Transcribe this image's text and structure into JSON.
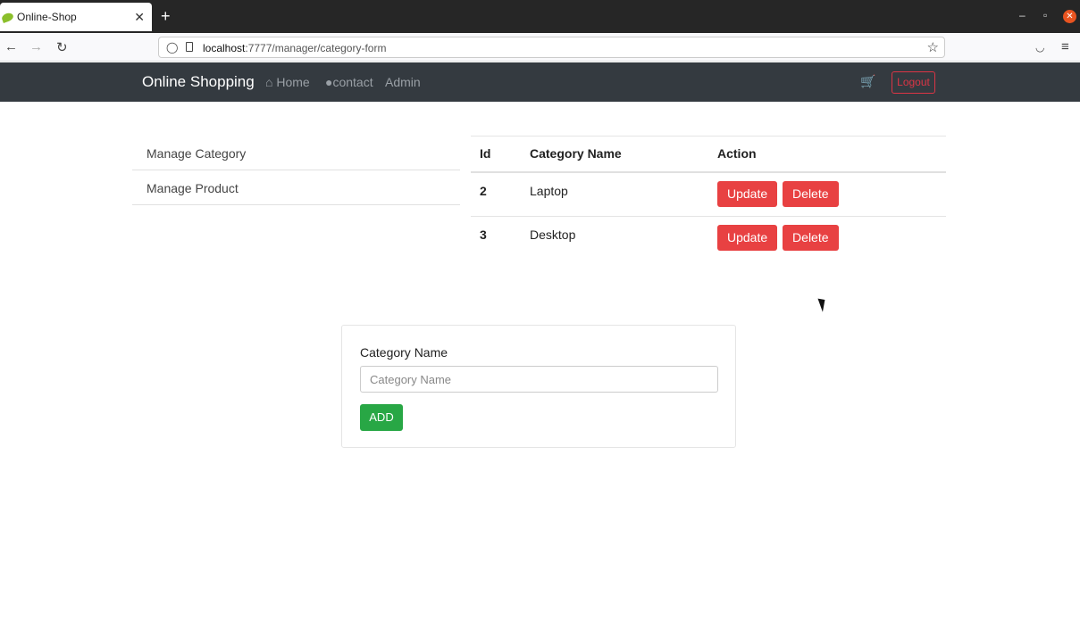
{
  "browser": {
    "tab_title": "Online-Shop",
    "tab_close": "✕",
    "new_tab": "+",
    "url_host": "localhost",
    "url_rest": ":7777/manager/category-form"
  },
  "site": {
    "brand": "Online Shopping",
    "nav": [
      {
        "label": "Home",
        "icon": "home-icon"
      },
      {
        "label": "contact",
        "icon": "comment-icon"
      },
      {
        "label": "Admin"
      }
    ],
    "logout": "Logout"
  },
  "sidebar": {
    "items": [
      {
        "label": "Manage Category"
      },
      {
        "label": "Manage Product"
      }
    ]
  },
  "table": {
    "headers": [
      "Id",
      "Category Name",
      "Action"
    ],
    "rows": [
      {
        "id": "2",
        "name": "Laptop",
        "update": "Update",
        "delete": "Delete"
      },
      {
        "id": "3",
        "name": "Desktop",
        "update": "Update",
        "delete": "Delete"
      }
    ]
  },
  "form": {
    "label": "Category Name",
    "placeholder": "Category Name",
    "value": "",
    "submit": "ADD"
  },
  "colors": {
    "navbar": "#343a40",
    "danger": "#e84142",
    "success": "#28a745"
  }
}
